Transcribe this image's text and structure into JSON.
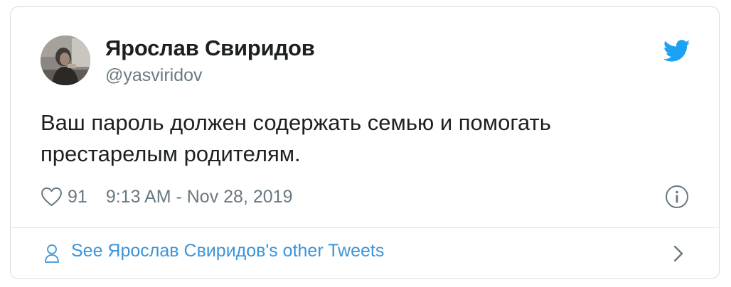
{
  "author": {
    "name": "Ярослав Свиридов",
    "handle": "@yasviridov"
  },
  "tweet": {
    "text": "Ваш пароль должен содержать семью и помогать престарелым родителям."
  },
  "meta": {
    "likes": "91",
    "timestamp": "9:13 AM - Nov 28, 2019"
  },
  "footer": {
    "link_text": "See Ярослав Свиридов's other Tweets"
  },
  "icons": {
    "logo": "twitter-bird-icon",
    "like": "heart-icon",
    "info": "info-icon",
    "profile": "person-icon",
    "navigate": "chevron-right-icon"
  },
  "colors": {
    "twitter_blue": "#1da1f2",
    "link_blue": "#3b94d9",
    "secondary_text": "#697882",
    "primary_text": "#1c2022",
    "border": "#d8dde2"
  }
}
